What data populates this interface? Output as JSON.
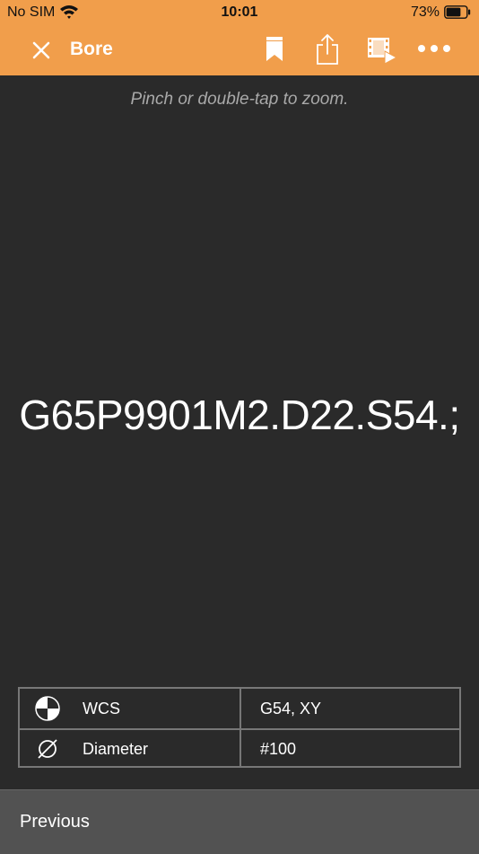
{
  "status": {
    "carrier": "No SIM",
    "time": "10:01",
    "battery_pct": "73%",
    "battery_level": 0.73
  },
  "nav": {
    "title": "Bore",
    "icons": [
      "close-icon",
      "bookmark-icon",
      "share-icon",
      "video-icon",
      "more-icon"
    ]
  },
  "main": {
    "hint": "Pinch or double-tap to zoom.",
    "code": "G65P9901M2.D22.S54.;"
  },
  "params": {
    "rows": [
      {
        "icon": "wcs-icon",
        "label": "WCS",
        "value": "G54, XY"
      },
      {
        "icon": "diameter-icon",
        "label": "Diameter",
        "value": "#100"
      }
    ]
  },
  "footer": {
    "previous_label": "Previous"
  },
  "colors": {
    "accent": "#f19e4b",
    "background": "#2a2a2a",
    "footer": "#525252"
  }
}
